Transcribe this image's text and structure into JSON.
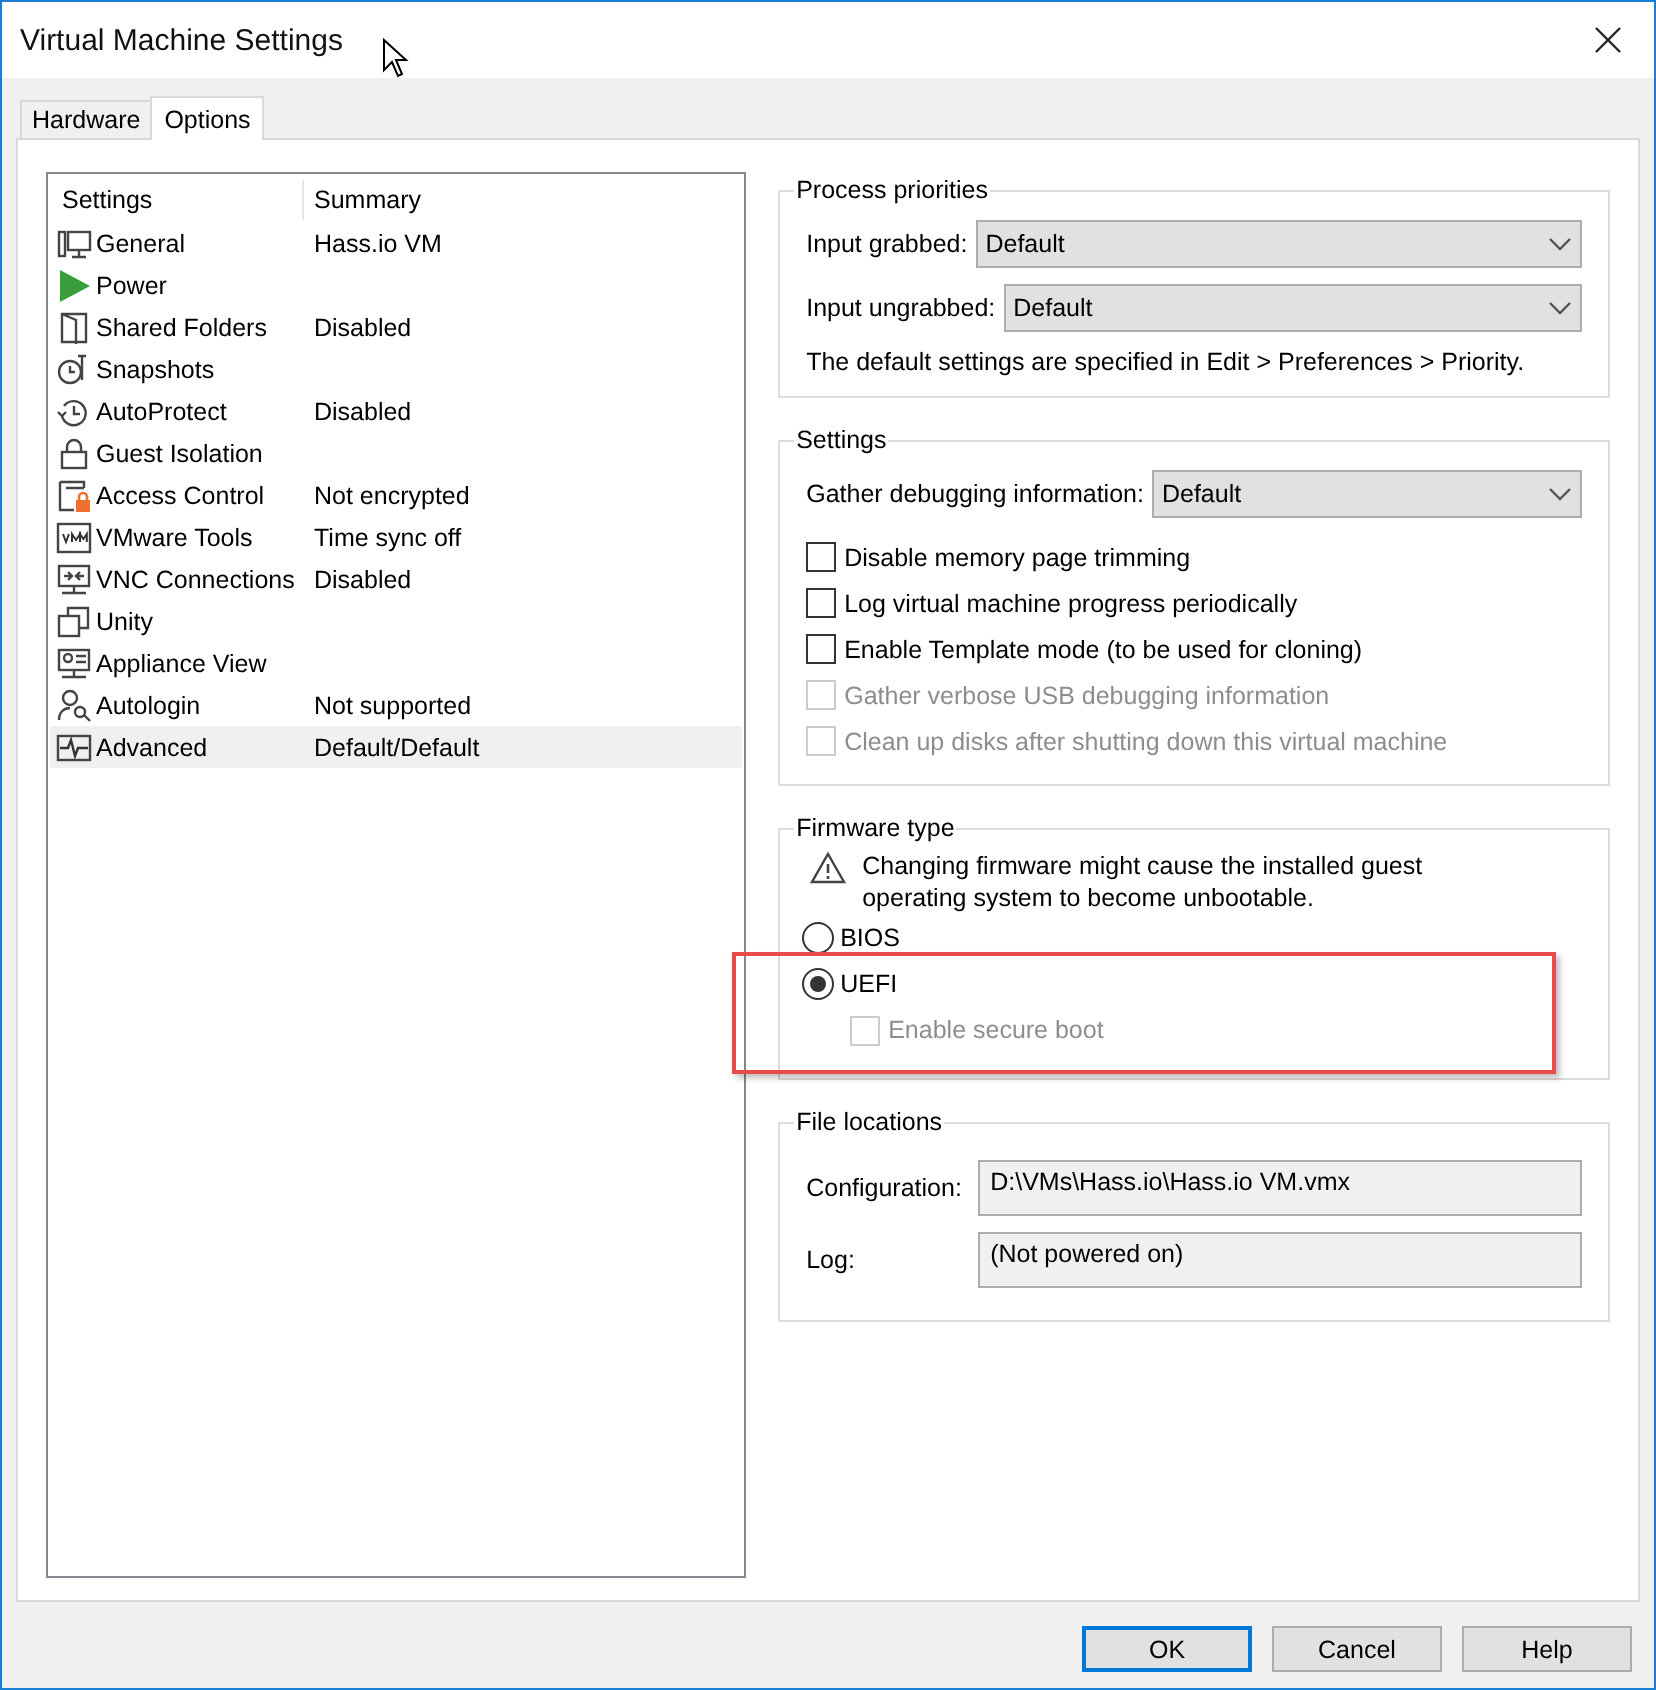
{
  "window": {
    "title": "Virtual Machine Settings"
  },
  "tabs": [
    {
      "label": "Hardware",
      "selected": false
    },
    {
      "label": "Options",
      "selected": true
    }
  ],
  "settings_list": {
    "columns": [
      "Settings",
      "Summary"
    ],
    "rows": [
      {
        "name": "General",
        "summary": "Hass.io VM",
        "selected": false
      },
      {
        "name": "Power",
        "selected": false
      },
      {
        "name": "Shared Folders",
        "summary": "Disabled",
        "selected": false
      },
      {
        "name": "Snapshots",
        "selected": false
      },
      {
        "name": "AutoProtect",
        "summary": "Disabled",
        "selected": false
      },
      {
        "name": "Guest Isolation",
        "selected": false
      },
      {
        "name": "Access Control",
        "summary": "Not encrypted",
        "selected": false
      },
      {
        "name": "VMware Tools",
        "summary": "Time sync off",
        "selected": false
      },
      {
        "name": "VNC Connections",
        "summary": "Disabled",
        "selected": false
      },
      {
        "name": "Unity",
        "selected": false
      },
      {
        "name": "Appliance View",
        "selected": false
      },
      {
        "name": "Autologin",
        "summary": "Not supported",
        "selected": false
      },
      {
        "name": "Advanced",
        "summary": "Default/Default",
        "selected": true
      }
    ]
  },
  "process_priorities": {
    "title": "Process priorities",
    "fields": [
      {
        "label": "Input grabbed:",
        "value": "Default"
      },
      {
        "label": "Input ungrabbed:",
        "value": "Default"
      }
    ],
    "note": "The default settings are specified in Edit > Preferences > Priority."
  },
  "settings": {
    "title": "Settings",
    "dropdown": {
      "label": "Gather debugging information:",
      "value": "Default"
    },
    "checkboxes": [
      {
        "label": "Disable memory page trimming",
        "checked": false,
        "disabled": false
      },
      {
        "label": "Log virtual machine progress periodically",
        "checked": false,
        "disabled": false
      },
      {
        "label": "Enable Template mode (to be used for cloning)",
        "checked": false,
        "disabled": false
      },
      {
        "label": "Gather verbose USB debugging information",
        "checked": false,
        "disabled": true
      },
      {
        "label": "Clean up disks after shutting down this virtual machine",
        "checked": false,
        "disabled": true
      }
    ]
  },
  "firmware": {
    "title": "Firmware type",
    "warning": "Changing firmware might cause the installed guest operating system to become unbootable.",
    "options": [
      {
        "label": "BIOS",
        "selected": false
      },
      {
        "label": "UEFI",
        "selected": true
      }
    ],
    "secure_boot": {
      "label": "Enable secure boot",
      "checked": false,
      "disabled": true
    }
  },
  "file_locations": {
    "title": "File locations",
    "fields": [
      {
        "label": "Configuration:",
        "value": "D:\\VMs\\Hass.io\\Hass.io VM.vmx"
      },
      {
        "label": "Log:",
        "value": "(Not powered on)"
      }
    ]
  },
  "highlight": {
    "kind": "rectangle"
  },
  "buttons": [
    {
      "label": "OK",
      "default": true
    },
    {
      "label": "Cancel",
      "default": false
    },
    {
      "label": "Help",
      "default": false
    }
  ]
}
